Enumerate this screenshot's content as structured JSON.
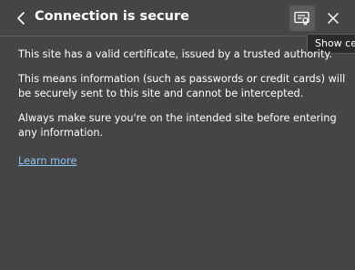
{
  "header": {
    "title": "Connection is secure",
    "icons": {
      "back": "chevron-left-icon",
      "certificate": "certificate-icon",
      "close": "close-icon"
    }
  },
  "tooltip": {
    "text": "Show certificate"
  },
  "content": {
    "paragraphs": [
      "This site has a valid certificate, issued by a trusted authority.",
      "This means information (such as passwords or credit cards) will be securely sent to this site and cannot be intercepted.",
      "Always make sure you're on the intended site before entering any information."
    ],
    "learn_more": "Learn more"
  },
  "colors": {
    "background": "#454545",
    "link": "#8ec5f2",
    "text": "#ffffff",
    "button_hover": "#5c5c5c"
  }
}
